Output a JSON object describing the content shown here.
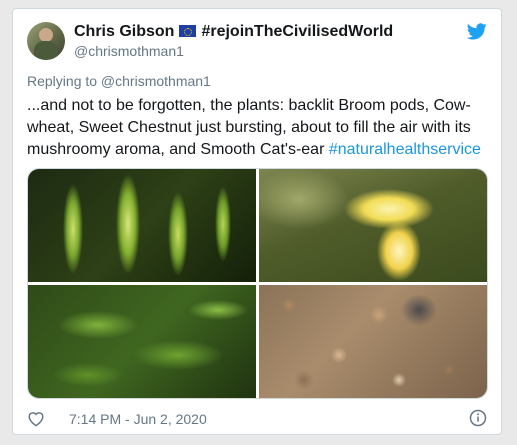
{
  "author": {
    "display_name": "Chris Gibson",
    "tag_text": "#rejoinTheCivilisedWorld",
    "handle": "@chrismothman1"
  },
  "reply": {
    "text": "Replying to @chrismothman1"
  },
  "tweet": {
    "text": "...and not to be forgotten, the plants: backlit Broom pods, Cow-wheat, Sweet Chestnut just bursting, about to fill the air with its mushroomy aroma, and Smooth Cat's-ear ",
    "hashtag": "#naturalhealthservice"
  },
  "footer": {
    "timestamp": "7:14 PM - Jun 2, 2020"
  },
  "icons": {
    "logo": "twitter-bird-icon",
    "flag": "eu-flag-icon",
    "like": "heart-icon",
    "info": "info-icon"
  },
  "colors": {
    "twitter_blue": "#1da1f2",
    "hashtag_blue": "#1b95e0",
    "secondary_text": "#657786",
    "primary_text": "#14171a"
  }
}
